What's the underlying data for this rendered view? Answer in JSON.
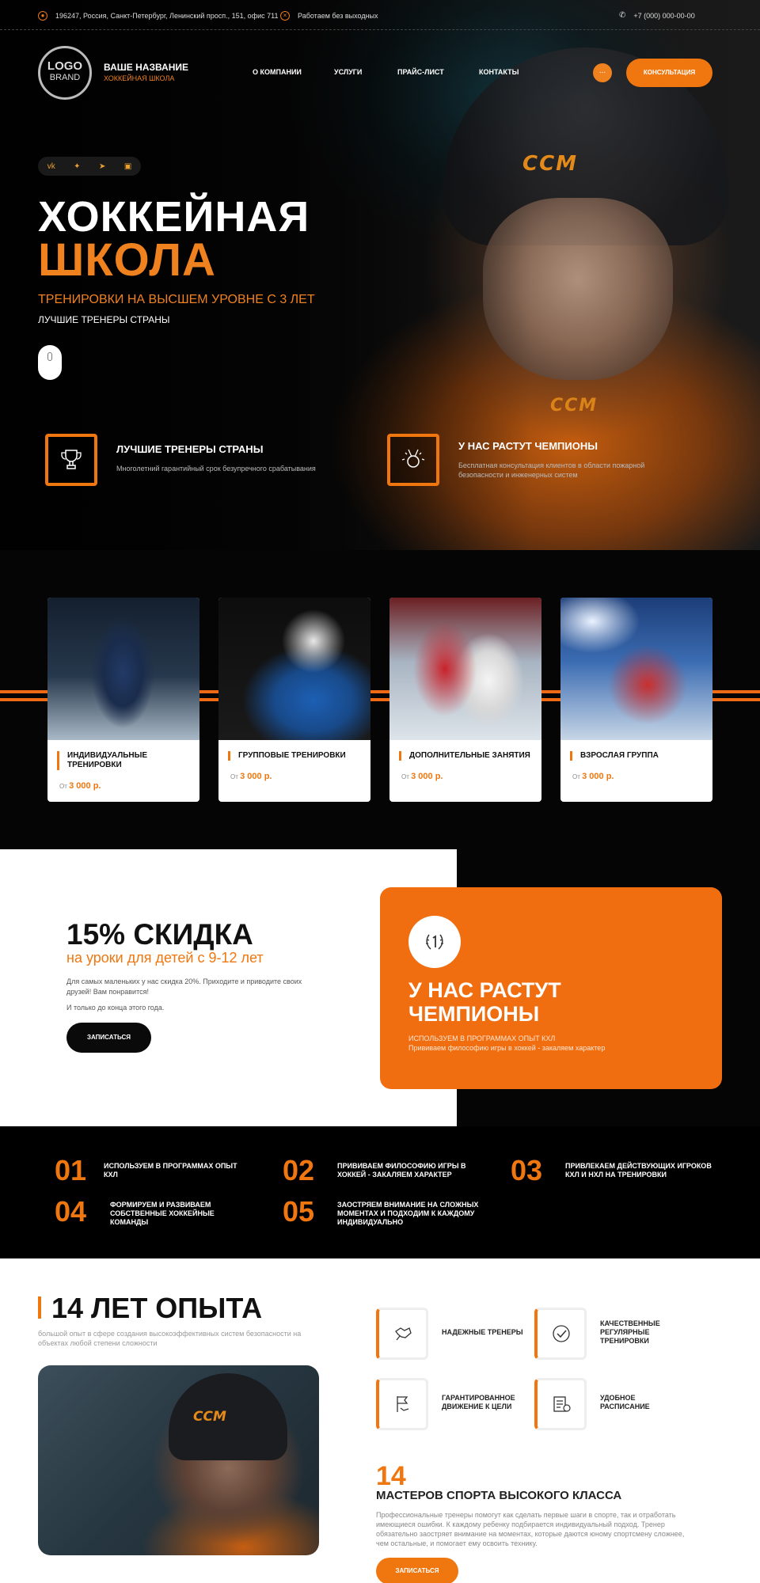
{
  "topbar": {
    "address": "196247, Россия, Санкт-Петербург, Ленинский просп., 151, офис 711",
    "hours": "Работаем без выходных",
    "phone": "+7 (000) 000-00-00"
  },
  "header": {
    "logo_line1": "LOGO",
    "logo_line2": "BRAND",
    "brand_title": "ВАШЕ НАЗВАНИЕ",
    "brand_subtitle": "ХОККЕЙНАЯ ШКОЛА",
    "nav": [
      "О КОМПАНИИ",
      "УСЛУГИ",
      "ПРАЙС-ЛИСТ",
      "КОНТАКТЫ"
    ],
    "more_label": "...",
    "consult_label": "КОНСУЛЬТАЦИЯ"
  },
  "socials": [
    "vk-icon",
    "twitter-icon",
    "telegram-icon",
    "instagram-icon"
  ],
  "hero": {
    "title_line1": "ХОККЕЙНАЯ",
    "title_line2": "ШКОЛА",
    "subtitle": "ТРЕНИРОВКИ НА ВЫСШЕМ УРОВНЕ С 3 ЛЕТ",
    "tagline": "ЛУЧШИЕ ТРЕНЕРЫ СТРАНЫ",
    "helmet_brand": "CCM",
    "features": [
      {
        "title": "ЛУЧШИЕ ТРЕНЕРЫ СТРАНЫ",
        "desc": "Многолетний гарантийный срок безупречного срабатывания",
        "icon": "trophy-icon"
      },
      {
        "title": "У НАС РАСТУТ ЧЕМПИОНЫ",
        "desc": "Бесплатная консультация клиентов в области пожарной безопасности и инженерных систем",
        "icon": "medal-icon"
      }
    ]
  },
  "services": [
    {
      "title": "ИНДИВИДУАЛЬНЫЕ ТРЕНИРОВКИ",
      "price_prefix": "От",
      "price": "3 000 р."
    },
    {
      "title": "ГРУППОВЫЕ ТРЕНИРОВКИ",
      "price_prefix": "От",
      "price": "3 000 р."
    },
    {
      "title": "ДОПОЛНИТЕЛЬНЫЕ ЗАНЯТИЯ",
      "price_prefix": "От",
      "price": "3 000 р."
    },
    {
      "title": "ВЗРОСЛАЯ ГРУППА",
      "price_prefix": "От",
      "price": "3 000 р."
    }
  ],
  "discount": {
    "title": "15% СКИДКА",
    "subtitle": "на уроки для детей с 9-12 лет",
    "text": "Для самых маленьких у нас скидка 20%. Приходите и приводите своих друзей! Вам понравится!",
    "text2": "И только до конца этого года.",
    "button": "ЗАПИСАТЬСЯ"
  },
  "champions": {
    "title": "У НАС РАСТУТ ЧЕМПИОНЫ",
    "line1": "ИСПОЛЬЗУЕМ В ПРОГРАММАХ ОПЫТ КХЛ",
    "line2": "Прививаем философию игры в хоккей - закаляем характер",
    "icon": "laurel-one-icon"
  },
  "points": [
    {
      "num": "01",
      "text": "ИСПОЛЬЗУЕМ В ПРОГРАММАХ ОПЫТ КХЛ"
    },
    {
      "num": "02",
      "text": "ПРИВИВАЕМ ФИЛОСОФИЮ ИГРЫ В ХОККЕЙ - ЗАКАЛЯЕМ ХАРАКТЕР"
    },
    {
      "num": "03",
      "text": "ПРИВЛЕКАЕМ ДЕЙСТВУЮЩИХ ИГРОКОВ КХЛ И НХЛ НА ТРЕНИРОВКИ"
    },
    {
      "num": "04",
      "text": "ФОРМИРУЕМ И РАЗВИВАЕМ СОБСТВЕННЫЕ ХОККЕЙНЫЕ КОМАНДЫ"
    },
    {
      "num": "05",
      "text": "ЗАОСТРЯЕМ ВНИМАНИЕ НА СЛОЖНЫХ МОМЕНТАХ И ПОДХОДИМ К КАЖДОМУ ИНДИВИДУАЛЬНО"
    }
  ],
  "experience": {
    "title": "14 ЛЕТ ОПЫТА",
    "subtitle": "большой опыт в сфере создания высокоэффективных систем безопасности на объектах любой степени сложности",
    "advantages": [
      {
        "label": "НАДЕЖНЫЕ ТРЕНЕРЫ",
        "icon": "handshake-icon"
      },
      {
        "label": "КАЧЕСТВЕННЫЕ РЕГУЛЯРНЫЕ ТРЕНИРОВКИ",
        "icon": "check-badge-icon"
      },
      {
        "label": "ГАРАНТИРОВАННОЕ ДВИЖЕНИЕ К ЦЕЛИ",
        "icon": "flag-hand-icon"
      },
      {
        "label": "УДОБНОЕ РАСПИСАНИЕ",
        "icon": "schedule-icon"
      }
    ],
    "masters_num": "14",
    "masters_title": "МАСТЕРОВ СПОРТА ВЫСОКОГО КЛАССА",
    "masters_text": "Профессиональные тренеры помогут как сделать первые шаги в спорте, так и отработать имеющиеся ошибки. К каждому ребенку подбирается индивидуальный подход. Тренер обязательно заостряет внимание на моментах, которые даются юному спортсмену сложнее, чем остальные, и помогает ему освоить технику.",
    "button": "ЗАПИСАТЬСЯ"
  },
  "colors": {
    "accent": "#f0770f",
    "dark": "#050505",
    "light": "#ffffff"
  }
}
